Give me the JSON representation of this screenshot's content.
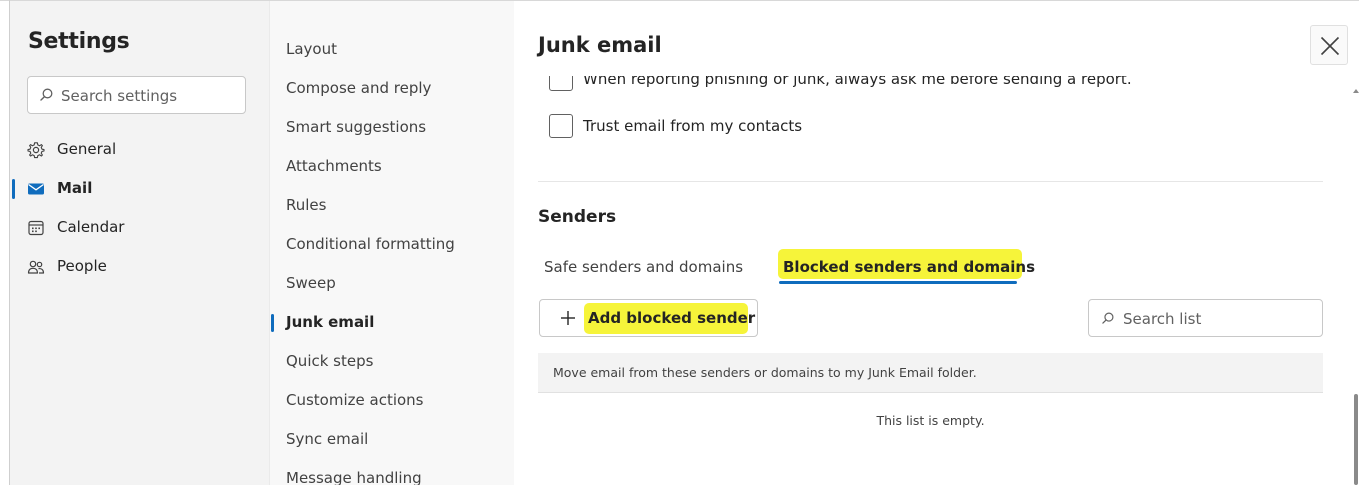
{
  "settings": {
    "title": "Settings",
    "search_placeholder": "Search settings",
    "categories": [
      {
        "label": "General",
        "icon": "gear-icon",
        "active": false
      },
      {
        "label": "Mail",
        "icon": "mail-icon",
        "active": true
      },
      {
        "label": "Calendar",
        "icon": "calendar-icon",
        "active": false
      },
      {
        "label": "People",
        "icon": "people-icon",
        "active": false
      }
    ]
  },
  "mail_nav": {
    "items": [
      {
        "label": "Layout"
      },
      {
        "label": "Compose and reply"
      },
      {
        "label": "Smart suggestions"
      },
      {
        "label": "Attachments"
      },
      {
        "label": "Rules"
      },
      {
        "label": "Conditional formatting"
      },
      {
        "label": "Sweep"
      },
      {
        "label": "Junk email",
        "active": true
      },
      {
        "label": "Quick steps"
      },
      {
        "label": "Customize actions"
      },
      {
        "label": "Sync email"
      },
      {
        "label": "Message handling"
      }
    ]
  },
  "panel": {
    "title": "Junk email",
    "close_icon": "close-icon",
    "options": [
      {
        "label": "When reporting phishing or junk, always ask me before sending a report.",
        "checked": false
      },
      {
        "label": "Trust email from my contacts",
        "checked": false
      }
    ],
    "senders": {
      "title": "Senders",
      "tabs": [
        {
          "label": "Safe senders and domains",
          "selected": false
        },
        {
          "label": "Blocked senders and domains",
          "selected": true
        }
      ],
      "add_button_label": "Add blocked sender",
      "search_placeholder": "Search list",
      "list_header": "Move email from these senders or domains to my Junk Email folder.",
      "empty_message": "This list is empty."
    }
  },
  "colors": {
    "accent": "#0f6cbd",
    "highlight": "#f6f43a",
    "sidebar_bg": "#f3f3f3",
    "nav_bg": "#f8f8f8"
  }
}
